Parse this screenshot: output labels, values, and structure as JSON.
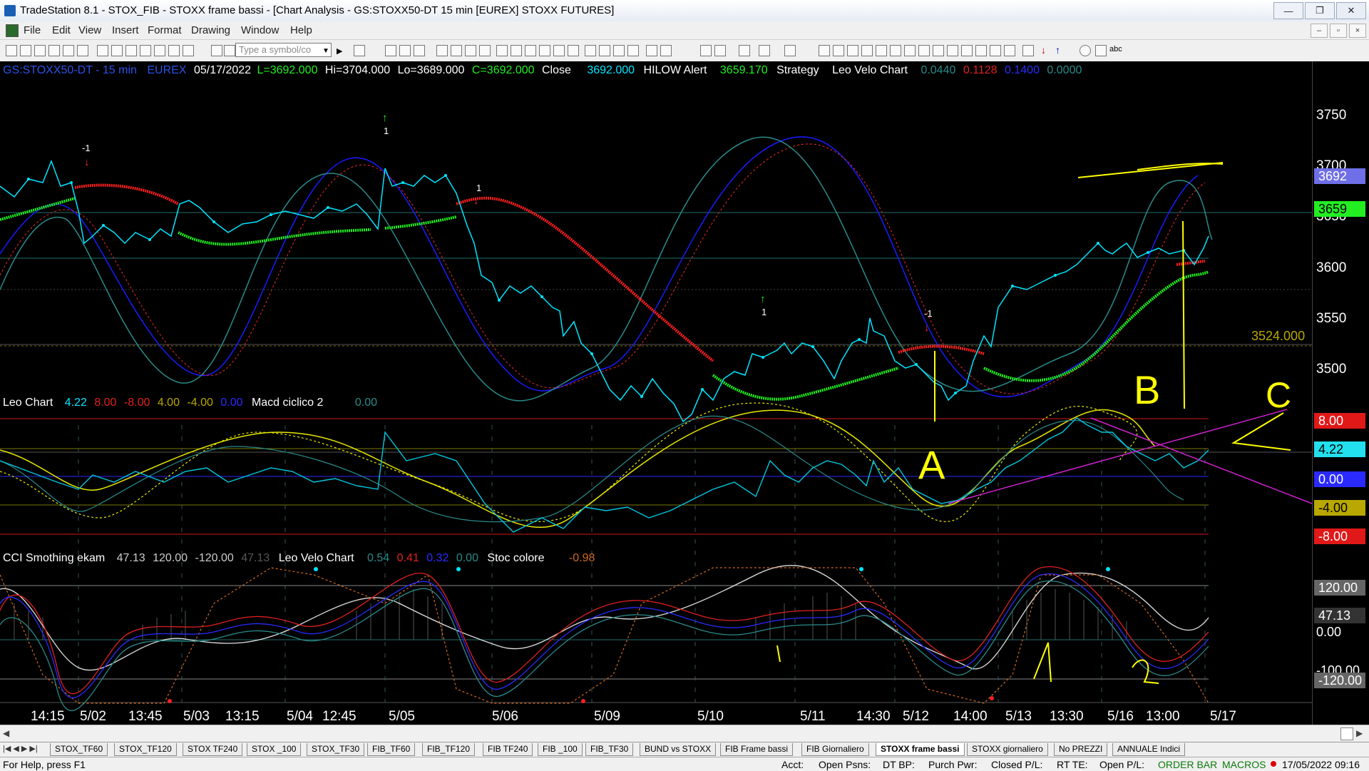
{
  "window": {
    "title": "TradeStation 8.1 - STOX_FIB - STOXX frame bassi - [Chart Analysis - GS:STOXX50-DT  15 min  [EUREX] STOXX FUTURES]",
    "buttons": [
      "—",
      "❐",
      "✕"
    ]
  },
  "menu": [
    "File",
    "Edit",
    "View",
    "Insert",
    "Format",
    "Drawing",
    "Window",
    "Help"
  ],
  "mdi_buttons": [
    "–",
    "▫",
    "×"
  ],
  "toolbar": {
    "symbol_placeholder": "Type a symbol/co",
    "text_tool": "abc"
  },
  "chart": {
    "header": {
      "symbol": "GS:STOXX50-DT - 15 min",
      "exchange": "EUREX",
      "date": "05/17/2022",
      "last": "L=3692.000",
      "high": "Hi=3704.000",
      "low": "Lo=3689.000",
      "close": "C=3692.000",
      "close_label": "Close",
      "close_value": "3692.000",
      "hilow_label": "HILOW Alert",
      "hilow_value": "3659.170",
      "strategy_label": "Strategy",
      "leo_label": "Leo Velo Chart",
      "leo_v1": "0.0440",
      "leo_v2": "0.1128",
      "leo_v3": "0.1400",
      "leo_v4": "0.0000"
    },
    "panel2_header": {
      "name": "Leo Chart",
      "v1": "4.22",
      "v2": "8.00",
      "v3": "-8.00",
      "v4": "4.00",
      "v5": "-4.00",
      "v6": "0.00",
      "macd_label": "Macd ciclico 2",
      "macd_value": "0.00"
    },
    "panel3_header": {
      "name": "CCI Smothing ekam",
      "v1": "47.13",
      "v2": "120.00",
      "v3": "-120.00",
      "v4": "47.13",
      "leo_label": "Leo Velo Chart",
      "lv1": "0.54",
      "lv2": "0.41",
      "lv3": "0.32",
      "lv4": "0.00",
      "stoc_label": "Stoc colore",
      "stoc_value": "-0.98"
    },
    "price_ticks": [
      "3750",
      "3700",
      "3650",
      "3600",
      "3550",
      "3500"
    ],
    "price_tags": {
      "last": "3692",
      "hilow": "3659"
    },
    "level_label": "3524.000",
    "panel2_tags": [
      "8.00",
      "4.22",
      "0.00",
      "-4.00",
      "-8.00"
    ],
    "panel3_tags": [
      "120.00",
      "47.13",
      "0.00",
      "-100.00",
      "-120.00"
    ],
    "trade_marks": [
      "-1",
      "1",
      "1",
      "1",
      "-1"
    ],
    "annotations": [
      "A",
      "B",
      "C"
    ],
    "time_labels": [
      "14:15",
      "5/02",
      "13:45",
      "5/03",
      "13:15",
      "5/04",
      "12:45",
      "5/05",
      "5/06",
      "5/09",
      "5/10",
      "5/11",
      "14:30",
      "5/12",
      "14:00",
      "5/13",
      "13:30",
      "5/16",
      "13:00",
      "5/17"
    ]
  },
  "tabs": [
    "STOX_TF60",
    "STOX_TF120",
    "STOX TF240",
    "STOX _100",
    "STOX_TF30",
    "FIB_TF60",
    "FIB_TF120",
    "FIB TF240",
    "FIB _100",
    "FIB_TF30",
    "BUND vs STOXX",
    "FIB Frame bassi",
    "FIB Giornaliero",
    "STOXX frame bassi",
    "STOXX giornaliero",
    "No PREZZI",
    "ANNUALE Indici"
  ],
  "active_tab": "STOXX frame bassi",
  "status": {
    "help": "For Help, press F1",
    "acct": "Acct:",
    "open_psns": "Open Psns:",
    "dt_bp": "DT BP:",
    "purch_pwr": "Purch Pwr:",
    "closed_pl": "Closed P/L:",
    "rt_te": "RT TE:",
    "open_pl": "Open P/L:",
    "orderbar": "ORDER BAR",
    "macros": "MACROS",
    "datetime": "17/05/2022 09:16"
  },
  "colors": {
    "background": "#000000",
    "price": "#00e5ff",
    "hilow_up": "#22ee22",
    "hilow_down": "#ff2020",
    "osc_yellow": "#e8e800",
    "annotation": "#ffff00",
    "trendline": "#cc22cc",
    "ma_blue": "#1a1aff",
    "ma_teal": "#2a8a8a"
  }
}
